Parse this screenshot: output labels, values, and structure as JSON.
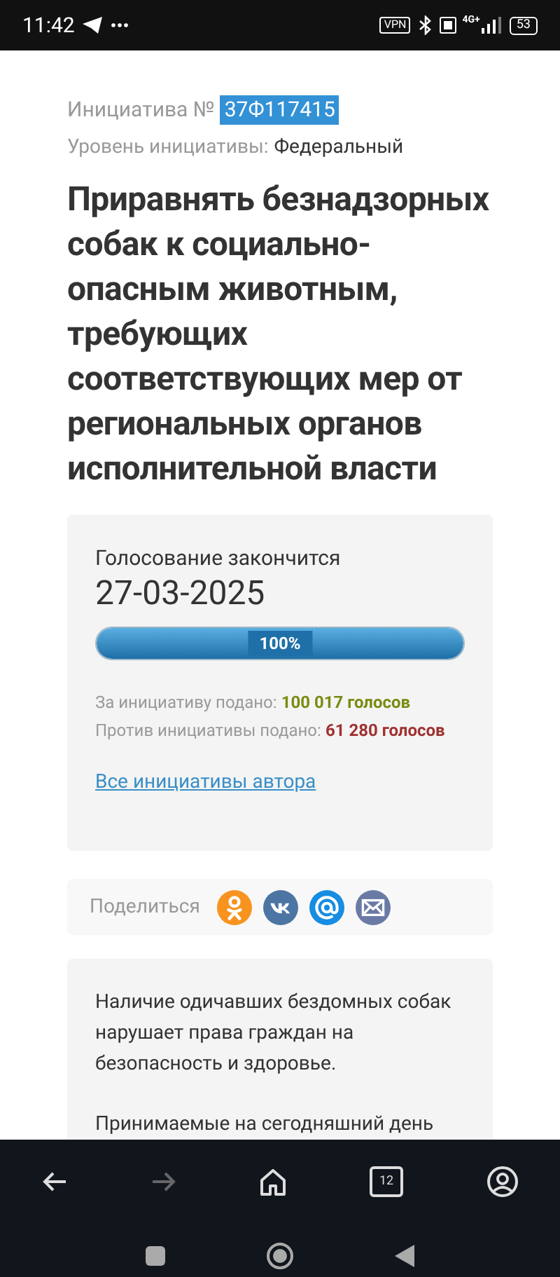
{
  "status_bar": {
    "time": "11:42",
    "vpn": "VPN",
    "network": "4G+",
    "battery": "53"
  },
  "initiative": {
    "number_label": "Инициатива №",
    "number": "37Ф117415",
    "level_label": "Уровень инициативы:",
    "level_value": "Федеральный"
  },
  "title": "Приравнять безнадзорных собак к социально-опасным животным, требующих соответствующих мер от региональных органов исполнительной власти",
  "voting": {
    "ends_label": "Голосование закончится",
    "date": "27-03-2025",
    "progress": {
      "level": 1,
      "label": "100%"
    },
    "for_label": "За инициативу подано:",
    "for_value": "100 017 голосов",
    "against_label": "Против инициативы подано:",
    "against_value": "61 280 голосов",
    "author_link": "Все инициативы автора"
  },
  "share": {
    "label": "Поделиться",
    "buttons": [
      {
        "kind": "ok",
        "color": "#f7931e"
      },
      {
        "kind": "vk",
        "color": "#4c75a3"
      },
      {
        "kind": "mail",
        "color": "#168de2"
      },
      {
        "kind": "email",
        "color": "#6a7aa5"
      }
    ]
  },
  "description": [
    "Наличие одичавших бездомных собак нарушает права граждан на безопасность и здоровье.",
    "Принимаемые на сегодняшний день"
  ],
  "browser_bar": {
    "tabs_count": "12"
  }
}
